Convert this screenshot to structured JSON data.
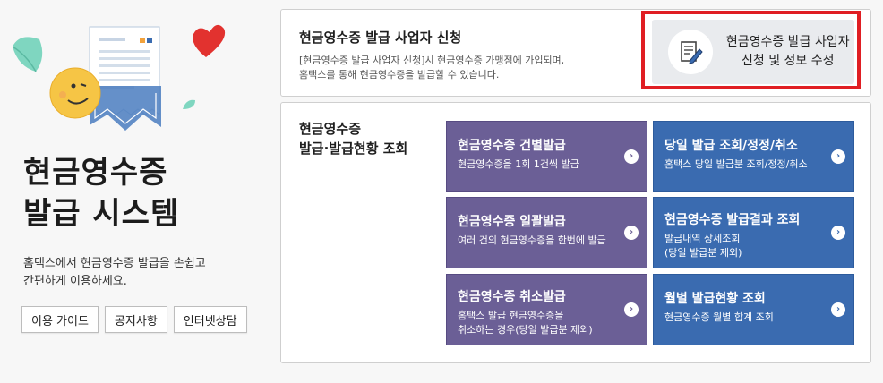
{
  "intro": {
    "title_line1": "현금영수증",
    "title_line2": "발급 시스템",
    "desc_line1": "홈택스에서 현금영수증 발급을 손쉽고",
    "desc_line2": "간편하게 이용하세요.",
    "links": [
      "이용 가이드",
      "공지사항",
      "인터넷상담"
    ]
  },
  "apply": {
    "title": "현금영수증 발급 사업자 신청",
    "desc_line1": "[현금영수증 발급 사업자 신청]시 현금영수증 가맹점에 가입되며,",
    "desc_line2": "홈택스를 통해 현금영수증을 발급할 수 있습니다.",
    "button_line1": "현금영수증 발급 사업자",
    "button_line2": "신청 및 정보 수정"
  },
  "issue": {
    "title_line1": "현금영수증",
    "title_line2": "발급·발급현황 조회",
    "tiles": [
      {
        "title": "현금영수증 건별발급",
        "sub1": "현금영수증을 1회 1건씩 발급",
        "sub2": ""
      },
      {
        "title": "당일 발급 조회/정정/취소",
        "sub1": "홈택스 당일 발급분 조회/정정/취소",
        "sub2": ""
      },
      {
        "title": "현금영수증 일괄발급",
        "sub1": "여러 건의 현금영수증을 한번에 발급",
        "sub2": ""
      },
      {
        "title": "현금영수증 발급결과 조회",
        "sub1": "발급내역 상세조회",
        "sub2": "(당일 발급분 제외)"
      },
      {
        "title": "현금영수증 취소발급",
        "sub1": "홈택스 발급 현금영수증을",
        "sub2": "취소하는 경우(당일 발급분 제외)"
      },
      {
        "title": "월별 발급현황 조회",
        "sub1": "현금영수증 월별 합계 조회",
        "sub2": ""
      }
    ]
  },
  "colors": {
    "tile_purple": "#6b5f96",
    "tile_blue": "#3a6bb0",
    "highlight_red": "#e01e23"
  },
  "icons": [
    "receipt-illustration",
    "smiley-icon",
    "heart-icon",
    "leaf-icon",
    "document-pen-icon",
    "chevron-right-icon"
  ]
}
